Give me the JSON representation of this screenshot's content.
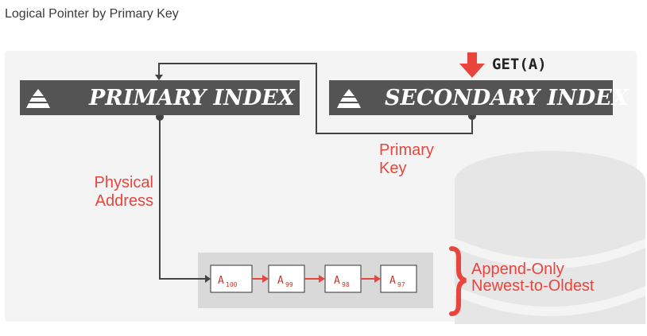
{
  "caption": "Logical Pointer by Primary Key",
  "diagram": {
    "primary_index_label": "PRIMARY INDEX",
    "secondary_index_label": "SECONDARY INDEX",
    "get_label": "GET(A)",
    "primary_key_label_line1": "Primary",
    "primary_key_label_line2": "Key",
    "physical_address_line1": "Physical",
    "physical_address_line2": "Address",
    "append_only_line1": "Append-Only",
    "append_only_line2": "Newest-to-Oldest",
    "version_chain": [
      {
        "base": "A",
        "sub": "100"
      },
      {
        "base": "A",
        "sub": "99"
      },
      {
        "base": "A",
        "sub": "98"
      },
      {
        "base": "A",
        "sub": "97"
      }
    ],
    "colors": {
      "index_box": "#545454",
      "accent_red": "#e8453c",
      "line": "#444444",
      "chain_bg": "#d9d9d9"
    }
  }
}
